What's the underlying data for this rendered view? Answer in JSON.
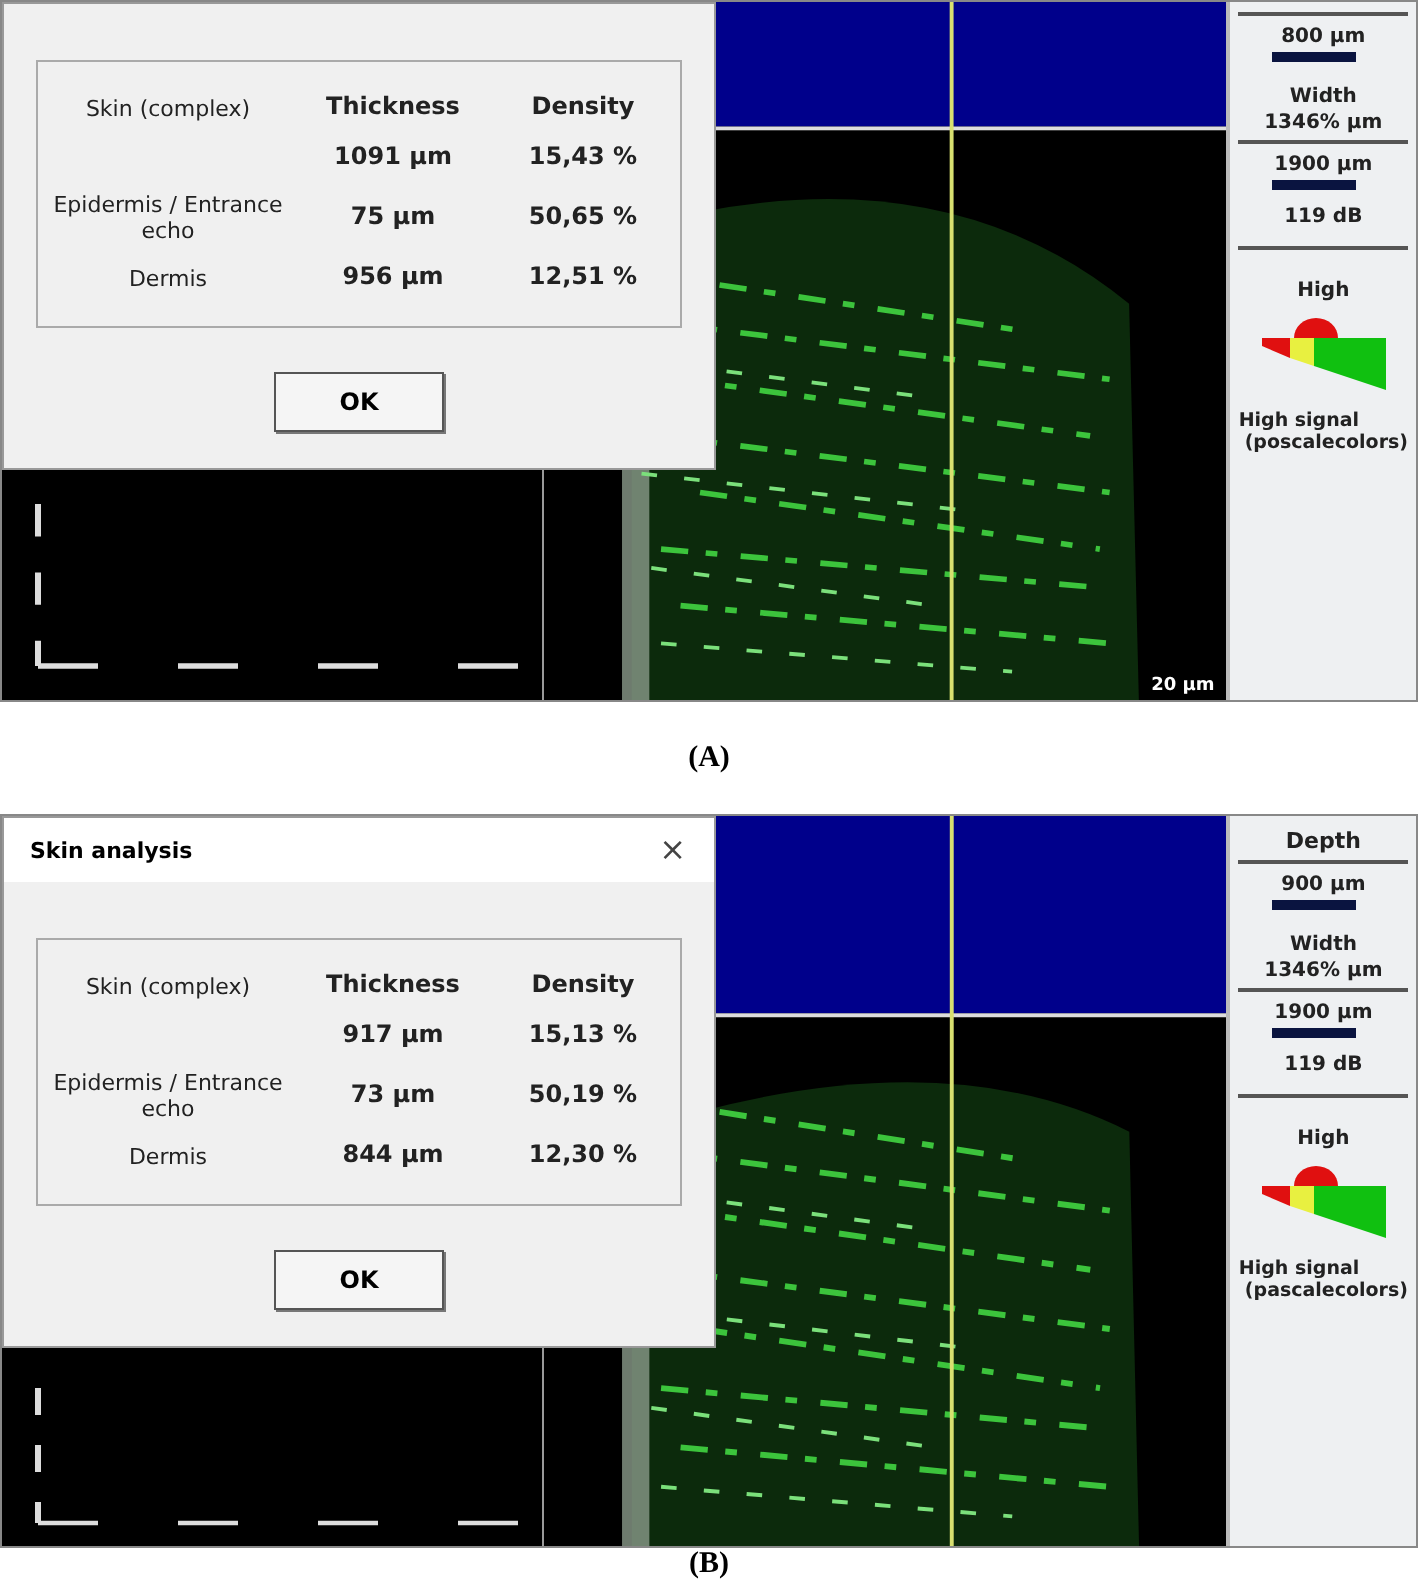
{
  "panels": [
    {
      "caption": "(A)",
      "dialog": {
        "columns": [
          "Thickness",
          "Density"
        ],
        "rows": [
          {
            "label": "Skin (complex)",
            "thickness": "1091 µm",
            "density": "15,43 %"
          },
          {
            "label": "Epidermis / Entrance echo",
            "thickness": "75 µm",
            "density": "50,65 %"
          },
          {
            "label": "Dermis",
            "thickness": "956 µm",
            "density": "12,51 %"
          }
        ],
        "button": "OK"
      },
      "scale": "20 µm",
      "side": {
        "depth": "800 µm",
        "width_label": "Width",
        "width": "1346% µm",
        "gain_depth": "1900 µm",
        "gain": "119 dB",
        "signal_level": "High",
        "signal_note": [
          "High signal",
          "(poscalecolors)"
        ]
      }
    },
    {
      "caption": "(B)",
      "dialog": {
        "title": "Skin analysis",
        "close": "×",
        "columns": [
          "Thickness",
          "Density"
        ],
        "rows": [
          {
            "label": "Skin (complex)",
            "thickness": "917 µm",
            "density": "15,13 %"
          },
          {
            "label": "Epidermis / Entrance echo",
            "thickness": "73 µm",
            "density": "50,19 %"
          },
          {
            "label": "Dermis",
            "thickness": "844 µm",
            "density": "12,30 %"
          }
        ],
        "button": "OK"
      },
      "side": {
        "heading": "Depth",
        "depth": "900 µm",
        "width_label": "Width",
        "width": "1346% µm",
        "gain_depth": "1900 µm",
        "gain": "119 dB",
        "signal_level": "High",
        "signal_note": [
          "High signal",
          "(pascalecolors)"
        ]
      }
    }
  ]
}
